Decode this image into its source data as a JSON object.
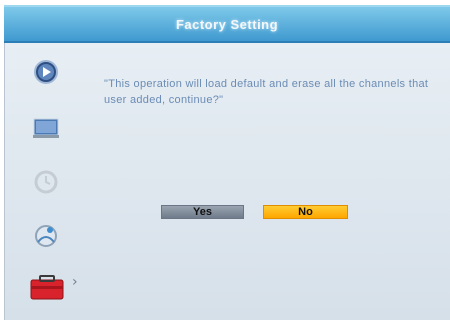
{
  "header": {
    "title": "Factory Setting"
  },
  "dialog": {
    "message": "\"This operation will load default and erase all the channels that user added, continue?\"",
    "yes_label": "Yes",
    "no_label": "No",
    "selected": "No"
  },
  "sidebar": {
    "items": [
      {
        "icon": "media-play-icon"
      },
      {
        "icon": "monitor-icon"
      },
      {
        "icon": "clock-icon"
      },
      {
        "icon": "globe-icon"
      },
      {
        "icon": "toolbox-icon",
        "active": true
      }
    ],
    "active_marker": "›"
  },
  "colors": {
    "title_bar": "#4aa6d8",
    "message_text": "#6b8cb5",
    "selected_button": "#ffb31a",
    "unselected_button": "#7f8a98"
  }
}
